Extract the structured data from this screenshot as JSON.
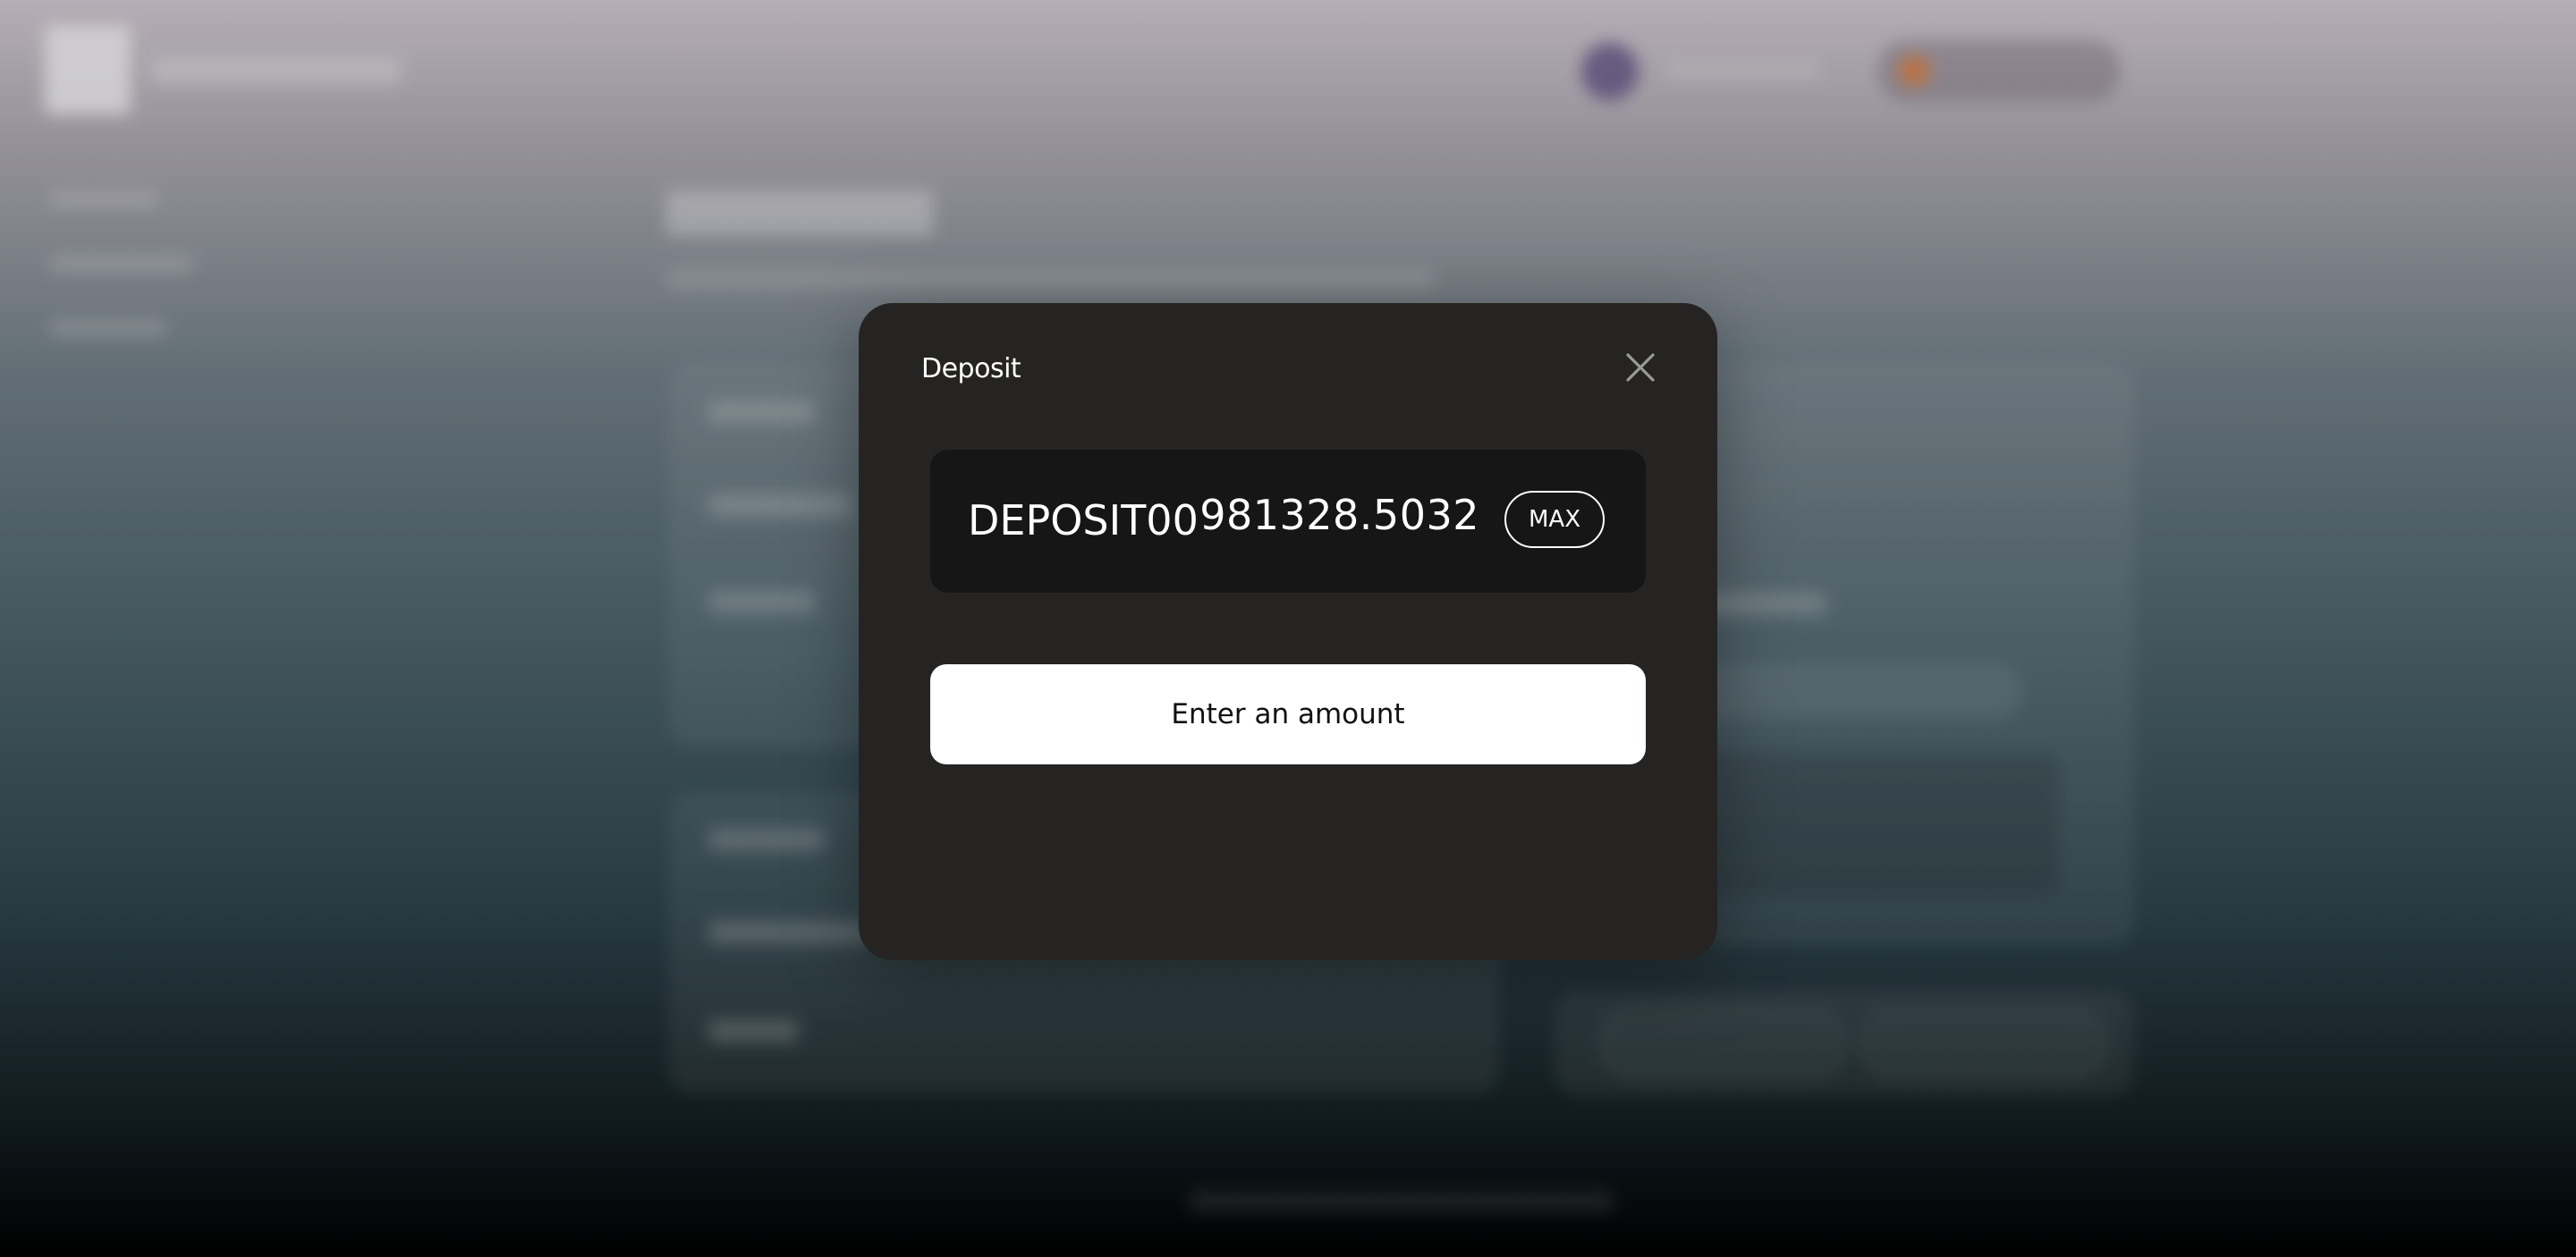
{
  "modal": {
    "title": "Deposit",
    "amount_placeholder": "DEPOSIT00",
    "balance": "981328.5032",
    "max_label": "MAX",
    "submit_label": "Enter an amount",
    "close_icon": "close-icon"
  },
  "colors": {
    "modal_bg": "#252422",
    "input_bg": "#161616",
    "button_bg": "#ffffff",
    "text": "#ffffff"
  }
}
